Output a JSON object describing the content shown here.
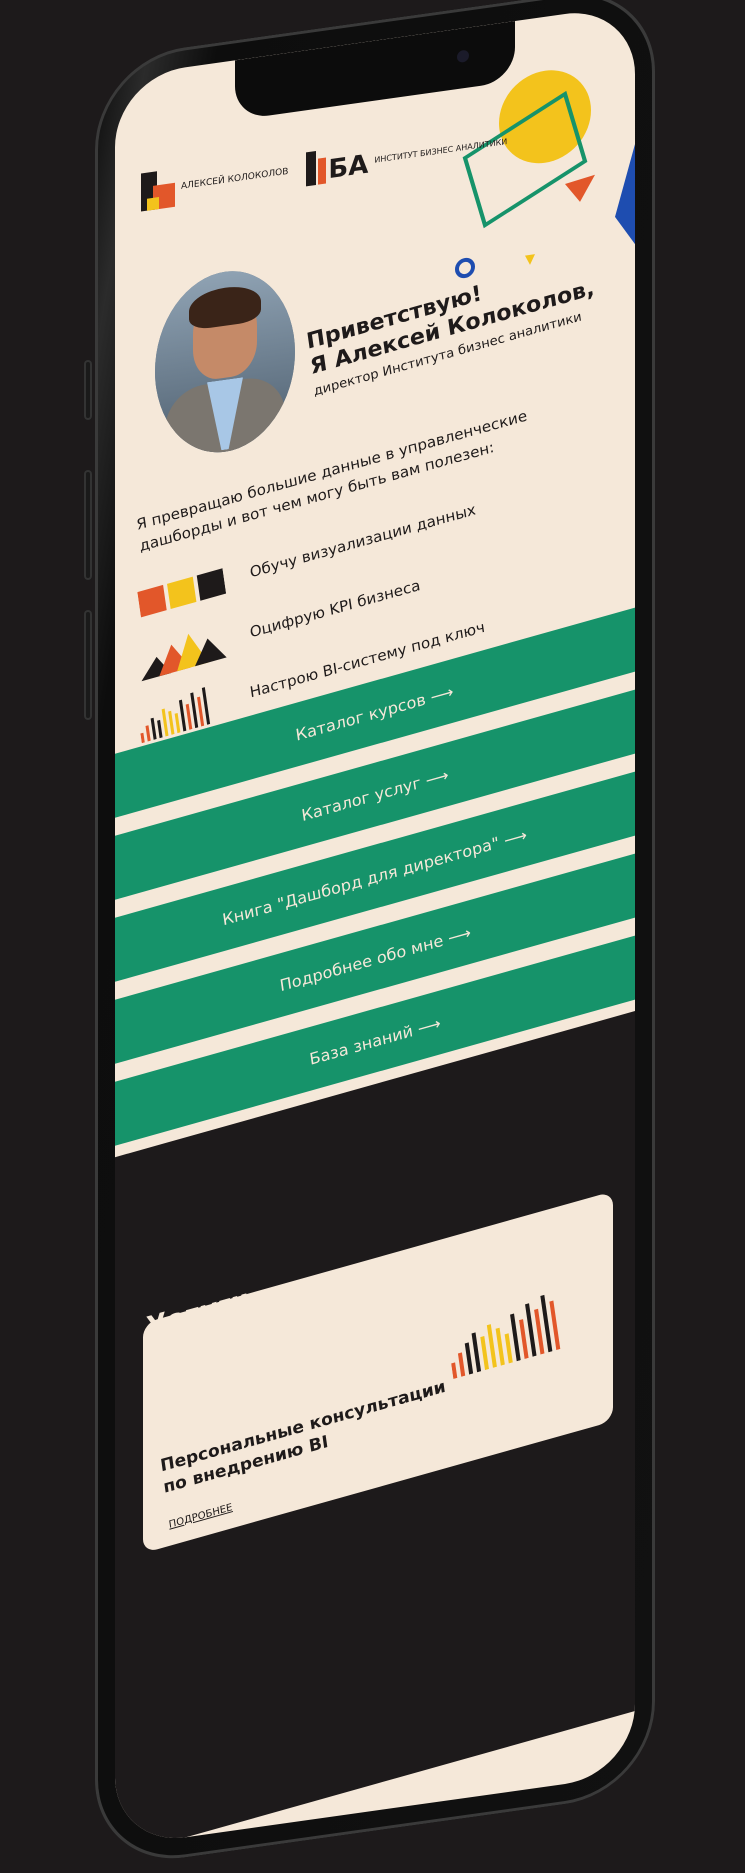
{
  "brand": {
    "ak_logo_text": "АЛЕКСЕЙ КОЛОКОЛОВ",
    "iba_logo_letters": "БА",
    "iba_logo_text": "ИНСТИТУТ БИЗНЕС АНАЛИТИКИ"
  },
  "hero": {
    "greeting_line1": "Приветствую!",
    "greeting_line2": "Я Алексей Колоколов,",
    "role": "директор Института бизнес аналитики"
  },
  "intro": "Я превращаю большие данные в управленческие дашборды и вот чем могу быть вам полезен:",
  "features": [
    {
      "icon": "color-squares-icon",
      "label": "Обучу визуализации данных"
    },
    {
      "icon": "mountains-icon",
      "label": "Оцифрую KPI бизнеса"
    },
    {
      "icon": "bar-histogram-icon",
      "label": "Настрою BI-систему под ключ"
    }
  ],
  "ctas": [
    {
      "label": "Каталог курсов ⟶"
    },
    {
      "label": "Каталог услуг ⟶"
    },
    {
      "label": "Книга \"Дашборд для директора\" ⟶"
    },
    {
      "label": "Подробнее обо мне ⟶"
    },
    {
      "label": "База знаний ⟶"
    }
  ],
  "services": {
    "title": "Услуги",
    "card_title": "Персональные консультации по внедрению BI",
    "card_link": "ПОДРОБНЕЕ"
  },
  "colors": {
    "accent_green": "#16936a",
    "background_cream": "#f5e8d9",
    "dark": "#1d1a1b",
    "orange": "#e2572a",
    "yellow": "#f3c31c"
  }
}
